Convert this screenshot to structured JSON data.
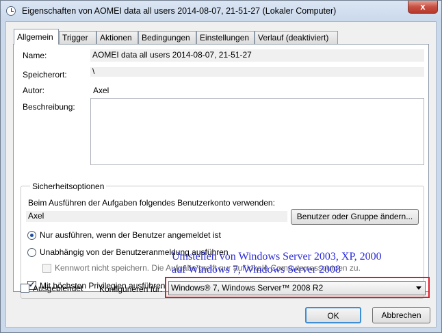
{
  "window": {
    "title": "Eigenschaften von AOMEI data all users 2014-08-07, 21-51-27 (Lokaler Computer)",
    "close_label": "x"
  },
  "tabs": [
    "Allgemein",
    "Trigger",
    "Aktionen",
    "Bedingungen",
    "Einstellungen",
    "Verlauf (deaktiviert)"
  ],
  "general": {
    "name_label": "Name:",
    "name_value": "AOMEI data all users 2014-08-07, 21-51-27",
    "location_label": "Speicherort:",
    "location_value": "\\",
    "author_label": "Autor:",
    "author_value": "Axel",
    "description_label": "Beschreibung:",
    "description_value": ""
  },
  "security": {
    "group_title": "Sicherheitsoptionen",
    "account_prompt": "Beim Ausführen der Aufgaben folgendes Benutzerkonto verwenden:",
    "account_value": "Axel",
    "change_user_button": "Benutzer oder Gruppe ändern...",
    "radio_logged_on": "Nur ausführen, wenn der Benutzer angemeldet ist",
    "radio_logged_on_checked": true,
    "radio_independent": "Unabhängig von der Benutzeranmeldung ausführen",
    "radio_independent_checked": false,
    "no_password_label": "Kennwort nicht speichern. Die Aufgabe greift nur auf lokale Computerressourcen zu.",
    "no_password_checked": false,
    "highest_privileges_label": "Mit höchsten Privilegien ausführen",
    "highest_privileges_checked": true
  },
  "bottom": {
    "hidden_label": "Ausgeblendet",
    "hidden_checked": false,
    "configure_label": "Konfigurieren für:",
    "configure_value": "Windows® 7, Windows Server™ 2008 R2"
  },
  "annotation": {
    "line1": "Umstellen von Windows Server 2003, XP, 2000",
    "line2": "auf Windows 7, Windows Server 2008",
    "color": "#2b2bd6",
    "box_color": "#e0192a"
  },
  "buttons": {
    "ok": "OK",
    "cancel": "Abbrechen"
  }
}
